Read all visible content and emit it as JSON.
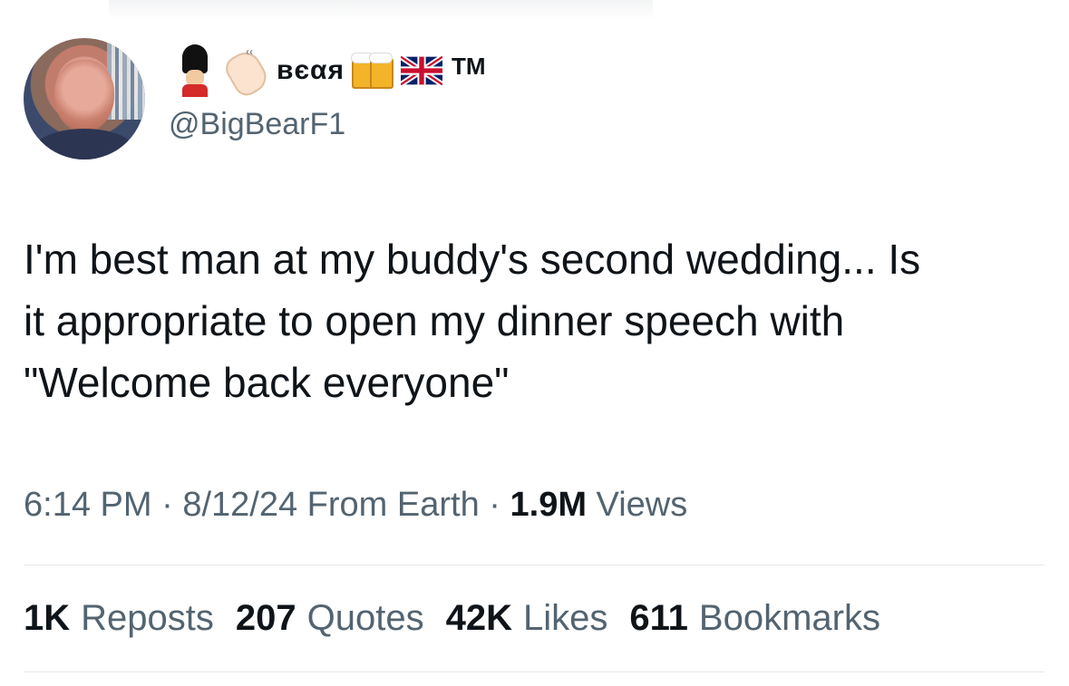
{
  "user": {
    "display_name": "вєαя",
    "trademark": "TM",
    "handle": "@BigBearF1",
    "name_icons": [
      "royal-guard-icon",
      "waving-hand-icon",
      "beer-mugs-icon",
      "union-jack-flag-icon"
    ]
  },
  "tweet": {
    "lines": [
      "I'm best man at my buddy's second wedding... Is",
      "it appropriate to open my dinner speech with",
      "\"Welcome back everyone\""
    ]
  },
  "meta": {
    "time": "6:14 PM",
    "date": "8/12/24",
    "source": "From Earth",
    "views_count": "1.9M",
    "views_label": "Views",
    "separator": "·"
  },
  "stats": [
    {
      "count": "1K",
      "label": "Reposts"
    },
    {
      "count": "207",
      "label": "Quotes"
    },
    {
      "count": "42K",
      "label": "Likes"
    },
    {
      "count": "611",
      "label": "Bookmarks"
    }
  ],
  "colors": {
    "text_primary": "#0f1419",
    "text_secondary": "#536471",
    "divider": "#e7e9ea"
  }
}
